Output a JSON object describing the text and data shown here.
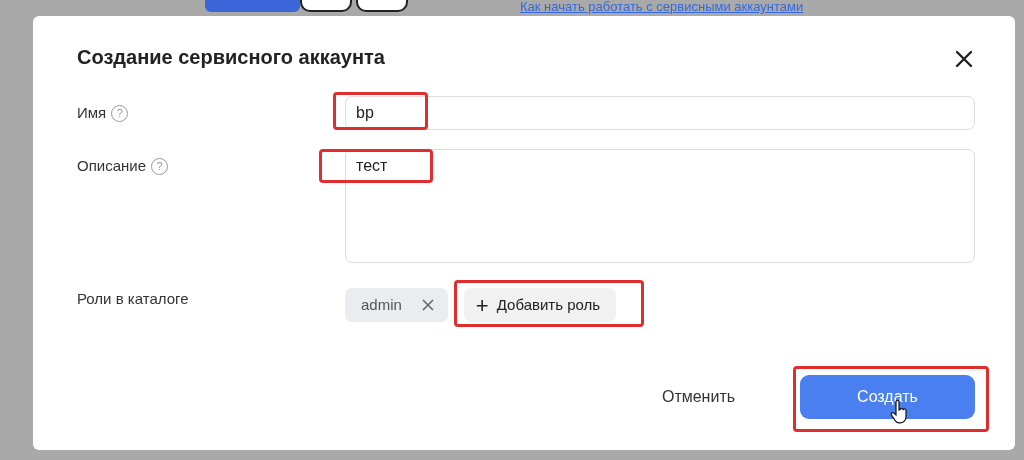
{
  "background_page": {
    "link": "Как начать работать с сервисными аккаунтами"
  },
  "dialog": {
    "title": "Создание сервисного аккаунта",
    "fields": [
      {
        "kind": "input",
        "label": "Имя",
        "help": "?",
        "value": "bp",
        "highlighted": true
      },
      {
        "kind": "textarea",
        "label": "Описание",
        "help": "?",
        "value": "тест",
        "highlighted": true
      },
      {
        "kind": "roles",
        "label": "Роли в каталоге",
        "tags": [
          {
            "label": "admin"
          }
        ],
        "add_button": {
          "icon": "+",
          "label": "Добавить роль",
          "highlighted": true
        }
      }
    ],
    "buttons": [
      {
        "kind": "secondary",
        "label": "Отменить"
      },
      {
        "kind": "primary",
        "label": "Создать",
        "highlighted": true
      }
    ]
  }
}
